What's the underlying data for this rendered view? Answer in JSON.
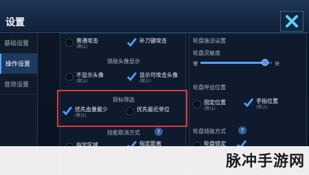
{
  "window": {
    "title": "设置"
  },
  "sidebar": {
    "items": [
      "基础设置",
      "操作设置",
      "音效设置"
    ],
    "active_index": 1
  },
  "left": {
    "row1": {
      "a_label": "普通攻击",
      "a_sub": "(默认)",
      "b_label": "补刀键攻击"
    },
    "avatar_section": "锁敌头像显示",
    "avatar": {
      "a_label": "不显示头像",
      "a_sub": "(默认)",
      "b_label": "显示可攻击头像",
      "b_sub": "(默认)"
    },
    "target_section": "目标筛选",
    "target": {
      "a_label": "优先血量最少",
      "a_sub": "(默认)",
      "b_label": "优先最近单位"
    },
    "skill_section": "技能取消方式",
    "skill": {
      "a_label": "指定区域",
      "b_label": "指定距离"
    }
  },
  "right": {
    "joystick_section": "轮盘施法设置",
    "sensitivity_label": "轮盘灵敏度",
    "slow": "慢",
    "fast": "快",
    "sensitivity_value": 0.9,
    "position_section": "轮盘呼出位置",
    "position": {
      "a_label": "固定位置",
      "a_sub": "(默认)",
      "b_label": "手指位置",
      "b_sub": "(默认)"
    },
    "lock_section": "轮盘锁敌方式",
    "lock": {
      "a_label": "轮盘锁定"
    }
  },
  "watermark": "脉冲手游网",
  "colors": {
    "highlight_box": "#e03a3a",
    "accent": "#5aa3ff"
  }
}
